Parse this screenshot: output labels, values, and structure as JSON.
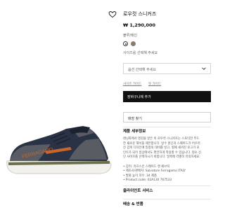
{
  "product": {
    "name": "로우컷 스니커즈",
    "price": "₩ 1,290,000",
    "color_label": "블루/레인",
    "size_hint": "사이즈를 선택해 주세요",
    "size_select_placeholder": "옵션 선택해 주세요",
    "links": [
      "사이즈 가이드",
      "핏 가이드"
    ],
    "add_to_cart": "장바구니에 추가",
    "find_store": "매장 찾기"
  },
  "details": {
    "heading": "제품 세부정보",
    "description": [
      "레닝화에서 영감을 받은 이 로우컷 스니커즈는 스포티한 무드",
      "한 새로운 해석을 제안합니다. 방수 원단과 스웨이드가 어우러",
      "진 갑피 디자인에 밑창의 대비를 넣고, 힐에 새겨진 로고가 포",
      "인트가 되어 일상에서도 편안하게 착용할 수 있습니다. 평소 신",
      "던 사이즈를 선택하시기 바랍니다. 얼룩에 각별히 유의하세요."
    ],
    "bullets": [
      "• 갑피: 카프스킨 스웨이드 앤 패브릭",
      "• 제조사/판매자: Salvatore Ferragamo ITALY",
      "• 발볼 높이 치수: 34 제품",
      "• Product code: 02A130 767533"
    ]
  },
  "sections": {
    "care": "클라이언트 서비스",
    "shipping": "배송 & 반품"
  },
  "gallery": {
    "brand_text": "FERRAGAMO"
  },
  "colors": {
    "upper": "#2a3245",
    "suede": "#5a5c63",
    "sole": "#f2f1ee",
    "midsole_stripe": "#6b6f4c",
    "accent": "#c8662e",
    "button": "#111111"
  }
}
